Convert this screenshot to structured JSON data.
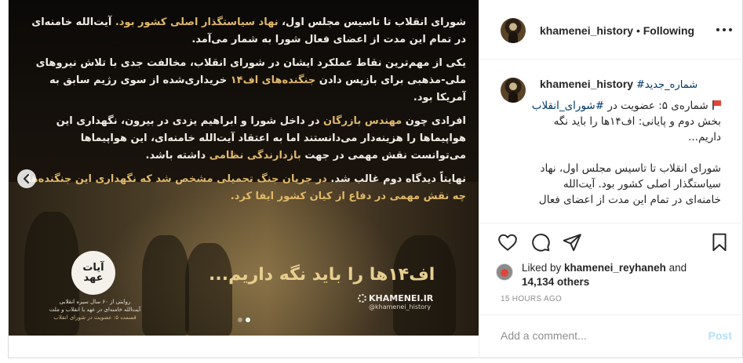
{
  "post": {
    "account": "khamenei_history",
    "separator": " • ",
    "follow_status": "Following"
  },
  "media": {
    "paragraphs": [
      [
        "شورای انقلاب تا تاسیس مجلس اول، ",
        "نهاد سیاستگذار اصلی کشور بود.",
        " آیت‌الله خامنه‌ای در تمام این مدت از اعضای فعال شورا به شمار می‌آمد."
      ],
      [
        "یکی از مهم‌ترین نقاط عملکرد ایشان در شورای انقلاب، مخالفت جدی با تلاش نیروهای ملی-مذهبی برای بازپس دادن ",
        "جنگنده‌های اف۱۴",
        " خریداری‌شده از سوی رژیم سابق به آمریکا بود."
      ],
      [
        "افرادی چون ",
        "مهندس بازرگان",
        " در داخل شورا و ابراهیم یزدی در بیرون، نگهداری این هواپیماها را هزینه‌دار می‌دانستند اما به اعتقاد آیت‌الله خامنه‌ای، این هواپیماها می‌توانست نقش مهمی در جهت ",
        "بازدارندگی نظامی",
        " داشته باشد."
      ],
      [
        "نهایتاً دیدگاه دوم غالب شد. ",
        "در جریان جنگ تحمیلی مشخص شد که نگهداری این جنگنده‌ها چه نقش مهمی در دفاع از کیان کشور ایفا کرد.",
        ""
      ]
    ],
    "slogan": "اف۱۴ها را باید نگه داریم...",
    "logo_text": "آیات عهد",
    "logo_caption_1": "روایتی از ۶۰ سال سیره انقلابی",
    "logo_caption_2": "آیت‌الله خامنه‌ای در عهد با انقلاب و ملت",
    "logo_caption_3": "قسمت ۵: عضویت در شورای انقلاب",
    "brand": "KHAMENEI.IR",
    "brand_sub": "@khamenei_history",
    "carousel": {
      "total_slides": 2,
      "active_slide": 2
    }
  },
  "caption": {
    "username": "khamenei_history",
    "hashtag": "#شماره_جدید",
    "line1": "شماره‌ی ۵: عضویت در ",
    "hashtag2": "#شورای_انقلاب",
    "line2": "بخش دوم و پایانی: اف۱۴ها را باید نگه داریم...",
    "line3": "شورای انقلاب تا تاسیس مجلس اول، نهاد سیاستگذار اصلی کشور بود. آیت‌الله خامنه‌ای در تمام این مدت از اعضای فعال"
  },
  "likes": {
    "prefix": "Liked by ",
    "user": "khamenei_reyhaneh",
    "mid": " and",
    "count": "14,134 others"
  },
  "timestamp": "15 HOURS AGO",
  "comment": {
    "placeholder": "Add a comment...",
    "post_label": "Post"
  }
}
